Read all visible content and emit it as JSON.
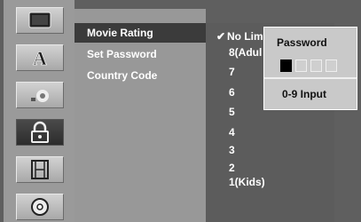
{
  "sidebar": {
    "icons": [
      {
        "name": "display-icon"
      },
      {
        "name": "language-icon",
        "glyph": "A"
      },
      {
        "name": "audio-icon"
      },
      {
        "name": "lock-icon",
        "active": true
      },
      {
        "name": "recording-icon"
      },
      {
        "name": "disc-icon"
      }
    ]
  },
  "menu": {
    "items": [
      {
        "label": "Movie Rating",
        "selected": true
      },
      {
        "label": "Set Password",
        "selected": false
      },
      {
        "label": "Country Code",
        "selected": false
      }
    ]
  },
  "options": {
    "checkmark": "✔",
    "items": [
      {
        "label": "No Lim",
        "checked": true
      },
      {
        "label": "8(Adul",
        "checked": false
      },
      {
        "label": "7",
        "checked": false
      },
      {
        "label": "6",
        "checked": false
      },
      {
        "label": "5",
        "checked": false
      },
      {
        "label": "4",
        "checked": false
      },
      {
        "label": "3",
        "checked": false
      },
      {
        "label": "2",
        "checked": false
      },
      {
        "label": "1(Kids)",
        "checked": false
      }
    ]
  },
  "password_popup": {
    "title": "Password",
    "digits_filled": 1,
    "digits_total": 4,
    "footer": "0-9 Input"
  },
  "colors": {
    "background": "#5f5f5f",
    "panel": "#989898",
    "selected": "#3b3b3b",
    "popup": "#c9c9c9"
  }
}
